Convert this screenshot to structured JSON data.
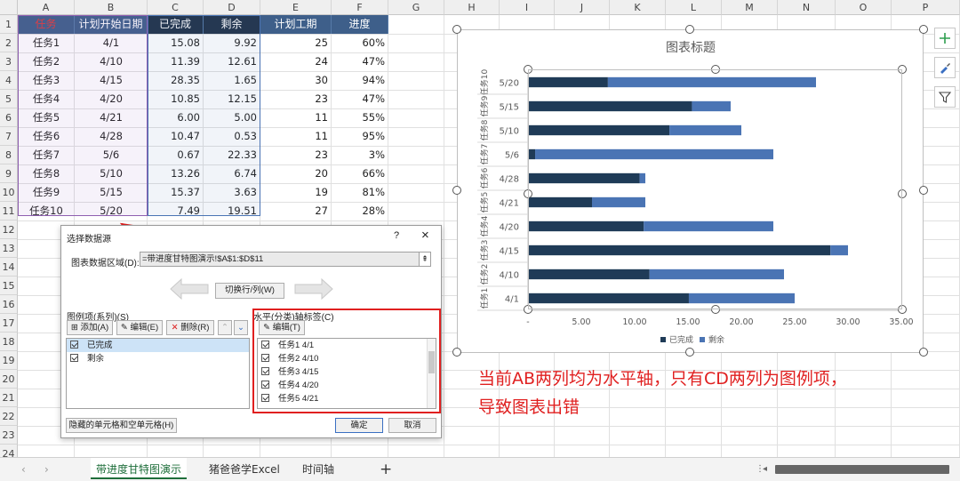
{
  "columns": [
    "A",
    "B",
    "C",
    "D",
    "E",
    "F",
    "G",
    "H",
    "I",
    "J",
    "K",
    "L",
    "M",
    "N",
    "O",
    "P"
  ],
  "rows": [
    "1",
    "2",
    "3",
    "4",
    "5",
    "6",
    "7",
    "8",
    "9",
    "10",
    "11",
    "12",
    "13",
    "14",
    "15",
    "16",
    "17",
    "18",
    "19",
    "20",
    "21",
    "22",
    "23",
    "24"
  ],
  "headers": {
    "task": "任务",
    "start": "计划开始日期",
    "done": "已完成",
    "remain": "剩余",
    "planned": "计划工期",
    "progress": "进度"
  },
  "table": [
    {
      "task": "任务1",
      "start": "4/1",
      "done": "15.08",
      "remain": "9.92",
      "planned": "25",
      "progress": "60%"
    },
    {
      "task": "任务2",
      "start": "4/10",
      "done": "11.39",
      "remain": "12.61",
      "planned": "24",
      "progress": "47%"
    },
    {
      "task": "任务3",
      "start": "4/15",
      "done": "28.35",
      "remain": "1.65",
      "planned": "30",
      "progress": "94%"
    },
    {
      "task": "任务4",
      "start": "4/20",
      "done": "10.85",
      "remain": "12.15",
      "planned": "23",
      "progress": "47%"
    },
    {
      "task": "任务5",
      "start": "4/21",
      "done": "6.00",
      "remain": "5.00",
      "planned": "11",
      "progress": "55%"
    },
    {
      "task": "任务6",
      "start": "4/28",
      "done": "10.47",
      "remain": "0.53",
      "planned": "11",
      "progress": "95%"
    },
    {
      "task": "任务7",
      "start": "5/6",
      "done": "0.67",
      "remain": "22.33",
      "planned": "23",
      "progress": "3%"
    },
    {
      "task": "任务8",
      "start": "5/10",
      "done": "13.26",
      "remain": "6.74",
      "planned": "20",
      "progress": "66%"
    },
    {
      "task": "任务9",
      "start": "5/15",
      "done": "15.37",
      "remain": "3.63",
      "planned": "19",
      "progress": "81%"
    },
    {
      "task": "任务10",
      "start": "5/20",
      "done": "7.49",
      "remain": "19.51",
      "planned": "27",
      "progress": "28%"
    }
  ],
  "chart_data": {
    "type": "bar",
    "orientation": "horizontal",
    "stacked": true,
    "title": "图表标题",
    "categories": [
      "任务1 4/1",
      "任务2 4/10",
      "任务3 4/15",
      "任务4 4/20",
      "任务5 4/21",
      "任务6 4/28",
      "任务7 5/6",
      "任务8 5/10",
      "任务9 5/15",
      "任务10 5/20"
    ],
    "outer_labels": [
      "任务1",
      "任务2",
      "任务3",
      "任务4",
      "任务5",
      "任务6",
      "任务7",
      "任务8",
      "任务9",
      "任务10"
    ],
    "inner_labels": [
      "4/1",
      "4/10",
      "4/15",
      "4/20",
      "4/21",
      "4/28",
      "5/6",
      "5/10",
      "5/15",
      "5/20"
    ],
    "series": [
      {
        "name": "已完成",
        "color": "#1f3b57",
        "values": [
          15.08,
          11.39,
          28.35,
          10.85,
          6.0,
          10.47,
          0.67,
          13.26,
          15.37,
          7.49
        ]
      },
      {
        "name": "剩余",
        "color": "#4a74b4",
        "values": [
          9.92,
          12.61,
          1.65,
          12.15,
          5.0,
          0.53,
          22.33,
          6.74,
          3.63,
          19.51
        ]
      }
    ],
    "xlim": [
      0,
      35
    ],
    "xticks": [
      "-",
      "5.00",
      "10.00",
      "15.00",
      "20.00",
      "25.00",
      "30.00",
      "35.00"
    ],
    "legend_position": "bottom",
    "grid": false
  },
  "annotation": {
    "line1": "当前AB两列均为水平轴，只有CD两列为图例项，",
    "line2": "导致图表出错",
    "color": "#e02020"
  },
  "dialog": {
    "title": "选择数据源",
    "help": "?",
    "close": "×",
    "range_label": "图表数据区域(D):",
    "range_value": "=带进度甘特图演示!$A$1:$D$11",
    "switch_label": "切换行/列(W)",
    "legend_title": "图例项(系列)(S)",
    "add": "添加(A)",
    "edit": "编辑(E)",
    "remove": "删除(R)",
    "legend_items": [
      "已完成",
      "剩余"
    ],
    "axis_title": "水平(分类)轴标签(C)",
    "axis_edit": "编辑(T)",
    "axis_items": [
      "任务1 4/1",
      "任务2 4/10",
      "任务3 4/15",
      "任务4 4/20",
      "任务5 4/21"
    ],
    "hidden_cells": "隐藏的单元格和空单元格(H)",
    "ok": "确定",
    "cancel": "取消"
  },
  "sheet_tabs": [
    "带进度甘特图演示",
    "猪爸爸学Excel",
    "时间轴"
  ],
  "add_sheet": "+"
}
